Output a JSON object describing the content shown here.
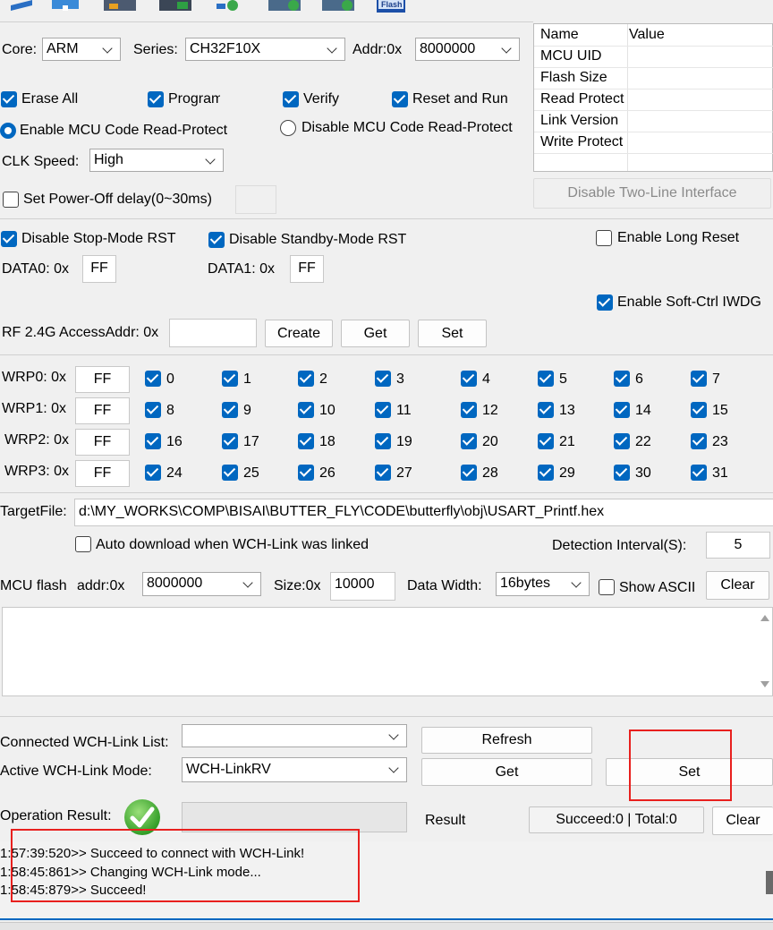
{
  "toolbar": {
    "icons": [
      "chip-icon",
      "usb-icon",
      "folder-icon",
      "download-icon",
      "verify-icon",
      "erase-icon",
      "gear-icon",
      "flash-icon"
    ],
    "flash_label": "Flash"
  },
  "core": {
    "label": "Core:",
    "value": "ARM"
  },
  "series": {
    "label": "Series:",
    "value": "CH32F10X"
  },
  "addr": {
    "label": "Addr:0x",
    "value": "8000000"
  },
  "info_table": {
    "headers": [
      "Name",
      "Value"
    ],
    "rows": [
      {
        "name": "MCU UID",
        "value": ""
      },
      {
        "name": "Flash Size",
        "value": ""
      },
      {
        "name": "Read Protect",
        "value": ""
      },
      {
        "name": "Link Version",
        "value": ""
      },
      {
        "name": "Write Protect",
        "value": ""
      }
    ]
  },
  "options": {
    "erase_all": "Erase All",
    "program": "Program",
    "verify": "Verify",
    "reset_run": "Reset and Run",
    "enable_protect": "Enable MCU Code Read-Protect",
    "disable_protect": "Disable MCU Code Read-Protect",
    "clk_label": "CLK Speed:",
    "clk_value": "High",
    "power_off": "Set Power-Off delay(0~30ms)",
    "disable_two_line": "Disable Two-Line Interface"
  },
  "rst": {
    "stop": "Disable Stop-Mode RST",
    "standby": "Disable Standby-Mode RST",
    "long_reset": "Enable Long Reset",
    "data0_label": "DATA0: 0x",
    "data0": "FF",
    "data1_label": "DATA1: 0x",
    "data1": "FF",
    "soft_iwdg": "Enable Soft-Ctrl IWDG"
  },
  "rf": {
    "label": "RF 2.4G AccessAddr: 0x",
    "value": "",
    "create": "Create",
    "get": "Get",
    "set": "Set"
  },
  "wrp": {
    "rows": [
      {
        "label": "WRP0: 0x",
        "value": "FF",
        "bits": [
          "0",
          "1",
          "2",
          "3",
          "4",
          "5",
          "6",
          "7"
        ]
      },
      {
        "label": "WRP1: 0x",
        "value": "FF",
        "bits": [
          "8",
          "9",
          "10",
          "11",
          "12",
          "13",
          "14",
          "15"
        ]
      },
      {
        "label": "WRP2: 0x",
        "value": "FF",
        "bits": [
          "16",
          "17",
          "18",
          "19",
          "20",
          "21",
          "22",
          "23"
        ]
      },
      {
        "label": "WRP3: 0x",
        "value": "FF",
        "bits": [
          "24",
          "25",
          "26",
          "27",
          "28",
          "29",
          "30",
          "31"
        ]
      }
    ]
  },
  "target": {
    "label": "TargetFile:",
    "value": "d:\\MY_WORKS\\COMP\\BISAI\\BUTTER_FLY\\CODE\\butterfly\\obj\\USART_Printf.hex"
  },
  "auto_download": {
    "label": "Auto download when WCH-Link was linked",
    "interval_label": "Detection Interval(S):",
    "interval": "5"
  },
  "flash_view": {
    "label": "MCU flash",
    "addr_label": "addr:0x",
    "addr": "8000000",
    "size_label": "Size:0x",
    "size": "10000",
    "width_label": "Data Width:",
    "width": "16bytes",
    "ascii": "Show ASCII",
    "clear": "Clear"
  },
  "link": {
    "list_label": "Connected WCH-Link List:",
    "list_value": "",
    "refresh": "Refresh",
    "mode_label": "Active WCH-Link  Mode:",
    "mode_value": "WCH-LinkRV",
    "get": "Get",
    "set": "Set"
  },
  "result": {
    "label": "Operation Result:",
    "result_label": "Result",
    "summary": "Succeed:0 | Total:0",
    "clear": "Clear"
  },
  "log": [
    "1:57:39:520>> Succeed to connect with WCH-Link!",
    "1:58:45:861>> Changing WCH-Link mode...",
    "1:58:45:879>> Succeed!"
  ]
}
